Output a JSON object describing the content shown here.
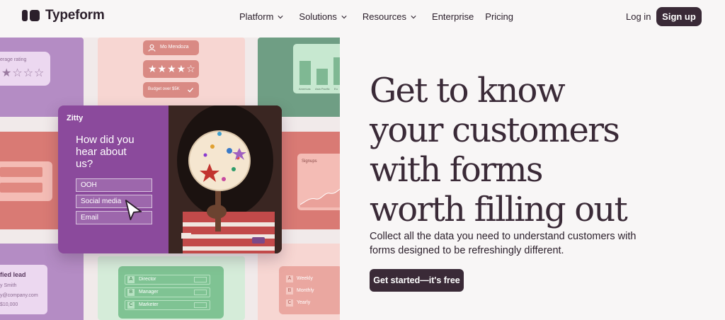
{
  "brand": {
    "name": "Typeform"
  },
  "nav": {
    "items": [
      {
        "label": "Platform",
        "has_dropdown": true
      },
      {
        "label": "Solutions",
        "has_dropdown": true
      },
      {
        "label": "Resources",
        "has_dropdown": true
      },
      {
        "label": "Enterprise",
        "has_dropdown": false
      },
      {
        "label": "Pricing",
        "has_dropdown": false
      }
    ],
    "login": "Log in",
    "signup": "Sign up"
  },
  "hero": {
    "title_lines": [
      "Get to know",
      "your customers",
      "with forms",
      "worth filling out"
    ],
    "subtitle": "Collect all the data you need to understand customers with forms designed to be refreshingly different.",
    "cta": "Get started—it's free"
  },
  "collage": {
    "rating_label": "erage rating",
    "rating_stars": "★☆☆☆",
    "name_chip": "Mo Mendoza",
    "stars_chip": "★★★★☆",
    "budget_chip": "Budget over $5K",
    "chart_labels": [
      "Americas",
      "Asia Pacific",
      "Eu"
    ],
    "signups_label": "Signups",
    "lead_title": "fied lead",
    "lead_name": "y Smith",
    "lead_email": "y@company.com",
    "lead_amount": "$10,000",
    "roles": [
      {
        "key": "A",
        "label": "Director"
      },
      {
        "key": "B",
        "label": "Manager"
      },
      {
        "key": "C",
        "label": "Marketer"
      }
    ],
    "frequency": [
      {
        "key": "A",
        "label": "Weekly"
      },
      {
        "key": "B",
        "label": "Monthly"
      },
      {
        "key": "C",
        "label": "Yearly"
      }
    ],
    "card": {
      "brand": "Zitty",
      "question": "How did you hear about us?",
      "options": [
        "OOH",
        "Social media",
        "Email"
      ]
    }
  },
  "colors": {
    "primary": "#3a2a37",
    "purple": "#8b4a9c",
    "pink": "#f7d6d2",
    "green": "#d5ecd9"
  }
}
